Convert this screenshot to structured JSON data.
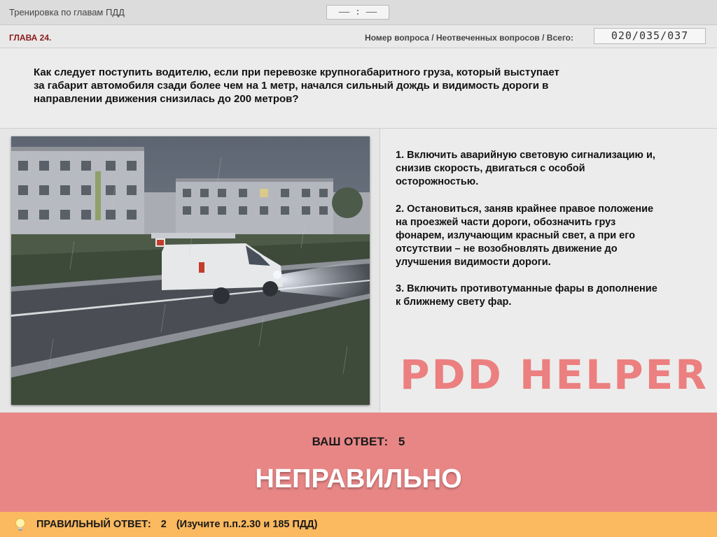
{
  "header": {
    "title": "Тренировка по главам ПДД",
    "timer": "‒‒ : ‒‒"
  },
  "infobar": {
    "chapter": "ГЛАВА 24.",
    "counter_label": "Номер вопроса / Неотвеченных вопросов / Всего:",
    "counter_value": "020/035/037"
  },
  "question": {
    "line1": "Как следует поступить водителю, если при перевозке крупногабаритного груза, который выступает",
    "line2": "за габарит автомобиля сзади более чем на 1 метр, начался сильный дождь и видимость дороги в",
    "line3": "направлении движения снизилась до 200 метров?"
  },
  "answers": [
    {
      "l1": "1.  Включить аварийную световую сигнализацию и,",
      "l2": "снизив скорость, двигаться с особой",
      "l3": "осторожностью."
    },
    {
      "l1": "2.  Остановиться, заняв крайнее правое положение",
      "l2": "на проезжей части дороги, обозначить груз",
      "l3": "фонарем, излучающим красный свет, а при его",
      "l4": "отсутствии – не возобновлять движение до",
      "l5": "улучшения видимости дороги."
    },
    {
      "l1": "3.  Включить противотуманные фары в дополнение",
      "l2": "к ближнему свету фар."
    }
  ],
  "watermark": "PDD HELPER",
  "result": {
    "your_answer_label": "ВАШ  ОТВЕТ:",
    "your_answer_value": "5",
    "verdict": "НЕПРАВИЛЬНО",
    "color": "#e88686"
  },
  "hint": {
    "label": "ПРАВИЛЬНЫЙ ОТВЕТ:",
    "value": "2",
    "reference": "(Изучите п.п.2.30 и 185 ПДД)",
    "icon": "lightbulb-icon",
    "color": "#fbb960"
  }
}
